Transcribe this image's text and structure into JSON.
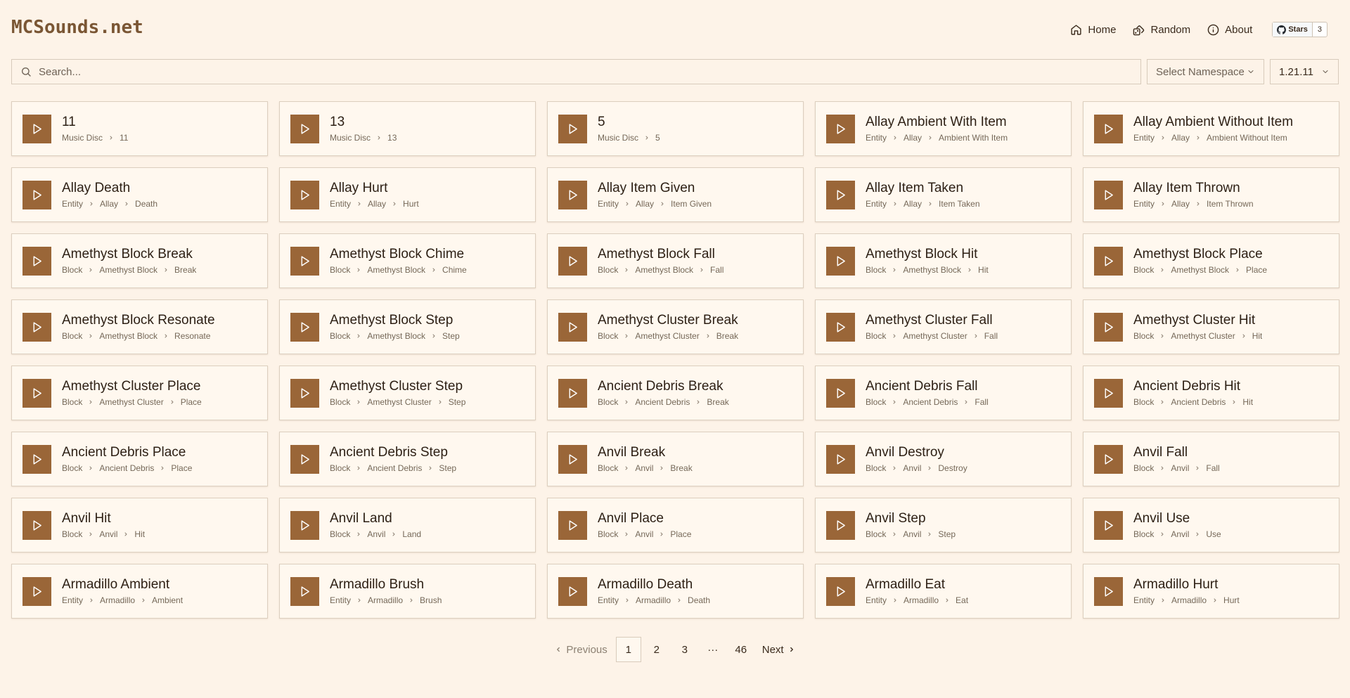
{
  "header": {
    "logo": "MCSounds.net",
    "nav": {
      "home": "Home",
      "random": "Random",
      "about": "About"
    },
    "github": {
      "label": "Stars",
      "count": "3"
    }
  },
  "search": {
    "placeholder": "Search..."
  },
  "filters": {
    "namespace": "Select Namespace",
    "version": "1.21.11"
  },
  "sounds": [
    {
      "title": "11",
      "path": [
        "Music Disc",
        "11"
      ]
    },
    {
      "title": "13",
      "path": [
        "Music Disc",
        "13"
      ]
    },
    {
      "title": "5",
      "path": [
        "Music Disc",
        "5"
      ]
    },
    {
      "title": "Allay Ambient With Item",
      "path": [
        "Entity",
        "Allay",
        "Ambient With Item"
      ]
    },
    {
      "title": "Allay Ambient Without Item",
      "path": [
        "Entity",
        "Allay",
        "Ambient Without Item"
      ]
    },
    {
      "title": "Allay Death",
      "path": [
        "Entity",
        "Allay",
        "Death"
      ]
    },
    {
      "title": "Allay Hurt",
      "path": [
        "Entity",
        "Allay",
        "Hurt"
      ]
    },
    {
      "title": "Allay Item Given",
      "path": [
        "Entity",
        "Allay",
        "Item Given"
      ]
    },
    {
      "title": "Allay Item Taken",
      "path": [
        "Entity",
        "Allay",
        "Item Taken"
      ]
    },
    {
      "title": "Allay Item Thrown",
      "path": [
        "Entity",
        "Allay",
        "Item Thrown"
      ]
    },
    {
      "title": "Amethyst Block Break",
      "path": [
        "Block",
        "Amethyst Block",
        "Break"
      ]
    },
    {
      "title": "Amethyst Block Chime",
      "path": [
        "Block",
        "Amethyst Block",
        "Chime"
      ]
    },
    {
      "title": "Amethyst Block Fall",
      "path": [
        "Block",
        "Amethyst Block",
        "Fall"
      ]
    },
    {
      "title": "Amethyst Block Hit",
      "path": [
        "Block",
        "Amethyst Block",
        "Hit"
      ]
    },
    {
      "title": "Amethyst Block Place",
      "path": [
        "Block",
        "Amethyst Block",
        "Place"
      ]
    },
    {
      "title": "Amethyst Block Resonate",
      "path": [
        "Block",
        "Amethyst Block",
        "Resonate"
      ]
    },
    {
      "title": "Amethyst Block Step",
      "path": [
        "Block",
        "Amethyst Block",
        "Step"
      ]
    },
    {
      "title": "Amethyst Cluster Break",
      "path": [
        "Block",
        "Amethyst Cluster",
        "Break"
      ]
    },
    {
      "title": "Amethyst Cluster Fall",
      "path": [
        "Block",
        "Amethyst Cluster",
        "Fall"
      ]
    },
    {
      "title": "Amethyst Cluster Hit",
      "path": [
        "Block",
        "Amethyst Cluster",
        "Hit"
      ]
    },
    {
      "title": "Amethyst Cluster Place",
      "path": [
        "Block",
        "Amethyst Cluster",
        "Place"
      ]
    },
    {
      "title": "Amethyst Cluster Step",
      "path": [
        "Block",
        "Amethyst Cluster",
        "Step"
      ]
    },
    {
      "title": "Ancient Debris Break",
      "path": [
        "Block",
        "Ancient Debris",
        "Break"
      ]
    },
    {
      "title": "Ancient Debris Fall",
      "path": [
        "Block",
        "Ancient Debris",
        "Fall"
      ]
    },
    {
      "title": "Ancient Debris Hit",
      "path": [
        "Block",
        "Ancient Debris",
        "Hit"
      ]
    },
    {
      "title": "Ancient Debris Place",
      "path": [
        "Block",
        "Ancient Debris",
        "Place"
      ]
    },
    {
      "title": "Ancient Debris Step",
      "path": [
        "Block",
        "Ancient Debris",
        "Step"
      ]
    },
    {
      "title": "Anvil Break",
      "path": [
        "Block",
        "Anvil",
        "Break"
      ]
    },
    {
      "title": "Anvil Destroy",
      "path": [
        "Block",
        "Anvil",
        "Destroy"
      ]
    },
    {
      "title": "Anvil Fall",
      "path": [
        "Block",
        "Anvil",
        "Fall"
      ]
    },
    {
      "title": "Anvil Hit",
      "path": [
        "Block",
        "Anvil",
        "Hit"
      ]
    },
    {
      "title": "Anvil Land",
      "path": [
        "Block",
        "Anvil",
        "Land"
      ]
    },
    {
      "title": "Anvil Place",
      "path": [
        "Block",
        "Anvil",
        "Place"
      ]
    },
    {
      "title": "Anvil Step",
      "path": [
        "Block",
        "Anvil",
        "Step"
      ]
    },
    {
      "title": "Anvil Use",
      "path": [
        "Block",
        "Anvil",
        "Use"
      ]
    },
    {
      "title": "Armadillo Ambient",
      "path": [
        "Entity",
        "Armadillo",
        "Ambient"
      ]
    },
    {
      "title": "Armadillo Brush",
      "path": [
        "Entity",
        "Armadillo",
        "Brush"
      ]
    },
    {
      "title": "Armadillo Death",
      "path": [
        "Entity",
        "Armadillo",
        "Death"
      ]
    },
    {
      "title": "Armadillo Eat",
      "path": [
        "Entity",
        "Armadillo",
        "Eat"
      ]
    },
    {
      "title": "Armadillo Hurt",
      "path": [
        "Entity",
        "Armadillo",
        "Hurt"
      ]
    }
  ],
  "pagination": {
    "previous": "Previous",
    "pages": [
      "1",
      "2",
      "3"
    ],
    "ellipsis": "···",
    "last": "46",
    "next": "Next",
    "current": "1"
  },
  "colors": {
    "background": "#fdf3e8",
    "accent": "#9a6638",
    "card": "#fff8ef"
  }
}
